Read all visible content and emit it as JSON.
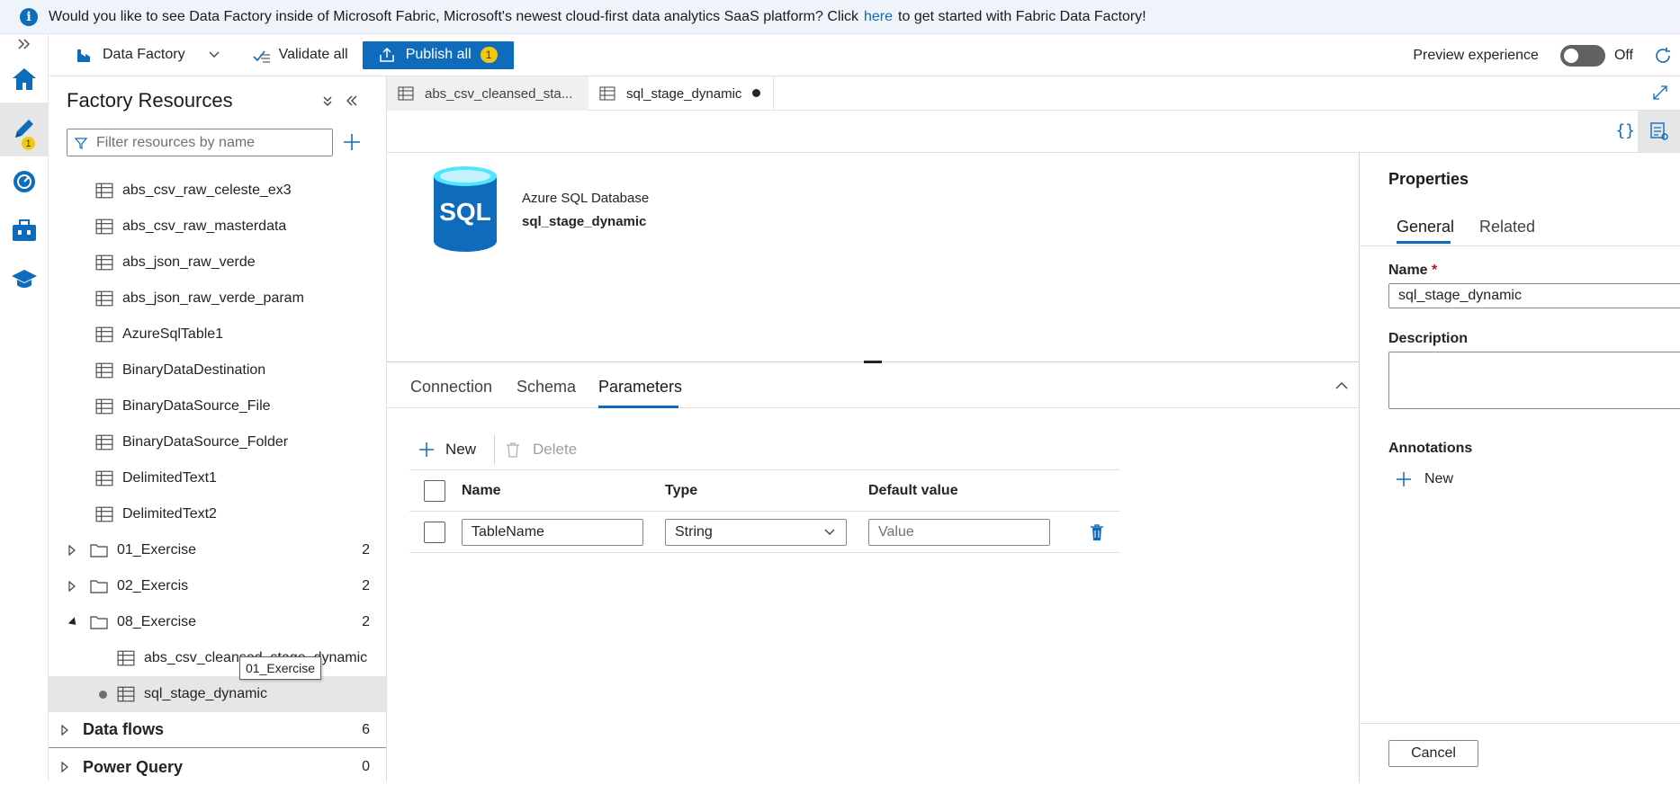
{
  "banner": {
    "text_before": "Would you like to see Data Factory inside of Microsoft Fabric, Microsoft's newest cloud-first data analytics SaaS platform? Click",
    "link": "here",
    "text_after": "to get started with Fabric Data Factory!"
  },
  "rail": {
    "author_badge": "1"
  },
  "toolbar": {
    "factory_name": "Data Factory",
    "validate_all": "Validate all",
    "publish_all": "Publish all",
    "publish_count": "1",
    "preview_label": "Preview experience",
    "toggle_state": "Off"
  },
  "resources": {
    "title": "Factory Resources",
    "filter_placeholder": "Filter resources by name",
    "datasets": [
      "abs_csv_raw_celeste_ex3",
      "abs_csv_raw_masterdata",
      "abs_json_raw_verde",
      "abs_json_raw_verde_param",
      "AzureSqlTable1",
      "BinaryDataDestination",
      "BinaryDataSource_File",
      "BinaryDataSource_Folder",
      "DelimitedText1",
      "DelimitedText2"
    ],
    "folders": [
      {
        "name": "01_Exercise",
        "count": "2"
      },
      {
        "name": "02_Exercis",
        "count": "2"
      },
      {
        "name": "08_Exercise",
        "count": "2"
      }
    ],
    "folder_children": [
      "abs_csv_cleansed_stage_dynamic",
      "sql_stage_dynamic"
    ],
    "sections": [
      {
        "name": "Data flows",
        "count": "6"
      },
      {
        "name": "Power Query",
        "count": "0"
      }
    ],
    "tooltip": "01_Exercise"
  },
  "tabs": [
    {
      "label": "abs_csv_cleansed_sta..."
    },
    {
      "label": "sql_stage_dynamic"
    }
  ],
  "canvas": {
    "db_logo_text": "SQL",
    "dataset_type": "Azure SQL Database",
    "dataset_name": "sql_stage_dynamic"
  },
  "bottom_tabs": [
    "Connection",
    "Schema",
    "Parameters"
  ],
  "params": {
    "new_label": "New",
    "delete_label": "Delete",
    "headers": {
      "name": "Name",
      "type": "Type",
      "default": "Default value"
    },
    "rows": [
      {
        "name": "TableName",
        "type": "String",
        "default_placeholder": "Value"
      }
    ]
  },
  "properties": {
    "title": "Properties",
    "tabs": [
      "General",
      "Related"
    ],
    "name_label": "Name",
    "required_mark": "*",
    "name_value": "sql_stage_dynamic",
    "description_label": "Description",
    "annotations_label": "Annotations",
    "annotations_new": "New",
    "cancel": "Cancel"
  },
  "colors": {
    "accent": "#0f6cbd",
    "badge": "#f2c811"
  }
}
